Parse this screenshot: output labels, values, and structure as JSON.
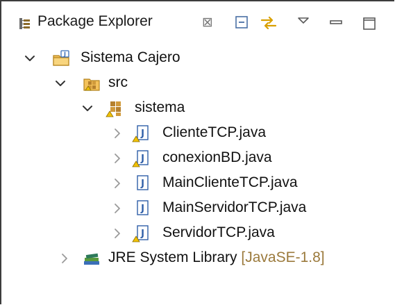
{
  "view": {
    "title": "Package Explorer",
    "close_glyph": "⊠"
  },
  "toolbar": {
    "buttons": [
      {
        "name": "collapse-all-icon"
      },
      {
        "name": "link-with-editor-icon"
      },
      {
        "name": "view-menu-icon"
      },
      {
        "name": "minimize-icon"
      },
      {
        "name": "maximize-icon"
      }
    ]
  },
  "tree": {
    "project": {
      "label": "Sistema Cajero",
      "icon": "java-project-icon"
    },
    "source_folder": {
      "label": "src",
      "icon": "source-folder-icon"
    },
    "package": {
      "label": "sistema",
      "icon": "package-warning-icon"
    },
    "files": [
      {
        "label": "ClienteTCP.java",
        "icon": "java-file-warning-icon",
        "warning": true
      },
      {
        "label": "conexionBD.java",
        "icon": "java-file-warning-icon",
        "warning": true
      },
      {
        "label": "MainClienteTCP.java",
        "icon": "java-file-icon",
        "warning": false
      },
      {
        "label": "MainServidorTCP.java",
        "icon": "java-file-icon",
        "warning": false
      },
      {
        "label": "ServidorTCP.java",
        "icon": "java-file-warning-icon",
        "warning": true
      }
    ],
    "library": {
      "label": "JRE System Library",
      "decoration": "[JavaSE-1.8]",
      "icon": "library-icon"
    }
  },
  "colors": {
    "text": "#111111",
    "decoration": "#9b7a3c",
    "java_file_blue": "#2f5fa8",
    "warning_yellow": "#f2c200",
    "package_brown": "#b5802d"
  }
}
